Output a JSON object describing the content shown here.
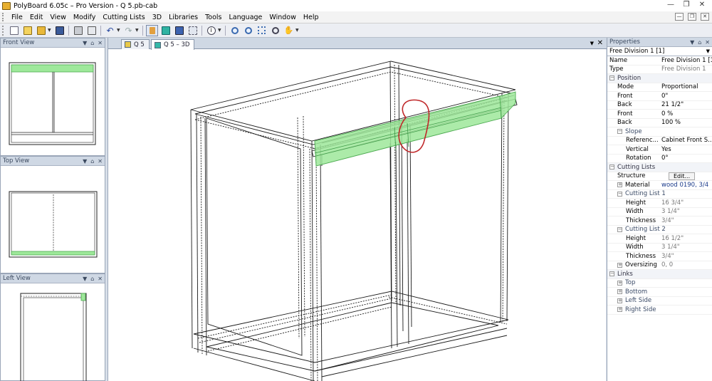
{
  "window": {
    "title": "PolyBoard 6.05c – Pro Version - Q 5.pb-cab"
  },
  "menu": {
    "items": [
      "File",
      "Edit",
      "View",
      "Modify",
      "Cutting Lists",
      "3D",
      "Libraries",
      "Tools",
      "Language",
      "Window",
      "Help"
    ]
  },
  "toolbar": {
    "icons": [
      "new-file-icon",
      "wizard-icon",
      "open-folder-icon",
      "save-icon",
      "print-icon",
      "print-preview-icon",
      "undo-icon",
      "redo-icon",
      "cursor-icon",
      "cube-icon",
      "render-icon",
      "explode-icon",
      "info-icon",
      "zoom-in-icon",
      "zoom-out-icon",
      "zoom-fit-icon",
      "zoom-window-icon",
      "pan-icon"
    ]
  },
  "panels": {
    "front_view": "Front View",
    "top_view": "Top View",
    "left_view": "Left View"
  },
  "tabs": [
    {
      "label": "Q 5"
    },
    {
      "label": "Q 5 – 3D"
    }
  ],
  "properties": {
    "header": "Properties",
    "selected": "Free Division 1 [1]",
    "rows": [
      {
        "k": "Name",
        "v": "Free Division 1 [1]",
        "kind": "plain"
      },
      {
        "k": "Type",
        "v": "Free Division 1",
        "kind": "ro"
      },
      {
        "k": "Position",
        "kind": "cat"
      },
      {
        "k": "Mode",
        "v": "Proportional",
        "kind": "ind"
      },
      {
        "k": "Front",
        "v": "0\"",
        "kind": "ind"
      },
      {
        "k": "Back",
        "v": "21 1/2\"",
        "kind": "ind"
      },
      {
        "k": "Front",
        "v": "0 %",
        "kind": "ind"
      },
      {
        "k": "Back",
        "v": "100 %",
        "kind": "ind"
      },
      {
        "k": "Slope",
        "kind": "subcat"
      },
      {
        "k": "Referenc...",
        "v": "Cabinet Front S...",
        "kind": "ind2"
      },
      {
        "k": "Vertical",
        "v": "Yes",
        "kind": "ind2"
      },
      {
        "k": "Rotation",
        "v": "0°",
        "kind": "ind2"
      },
      {
        "k": "Cutting Lists",
        "kind": "cat"
      },
      {
        "k": "Structure",
        "v": "Edit...",
        "kind": "button"
      },
      {
        "k": "Material",
        "v": "wood 0190, 3/4",
        "kind": "expand",
        "color": "#1a3a8a"
      },
      {
        "k": "Cutting List 1",
        "kind": "subcat"
      },
      {
        "k": "Height",
        "v": "16 3/4\"",
        "kind": "ind2ro"
      },
      {
        "k": "Width",
        "v": "3 1/4\"",
        "kind": "ind2ro"
      },
      {
        "k": "Thickness",
        "v": "3/4\"",
        "kind": "ind2ro"
      },
      {
        "k": "Cutting List 2",
        "kind": "subcat"
      },
      {
        "k": "Height",
        "v": "16 1/2\"",
        "kind": "ind2ro"
      },
      {
        "k": "Width",
        "v": "3 1/4\"",
        "kind": "ind2ro"
      },
      {
        "k": "Thickness",
        "v": "3/4\"",
        "kind": "ind2ro"
      },
      {
        "k": "Oversizing",
        "v": "0, 0",
        "kind": "expandro"
      },
      {
        "k": "Links",
        "kind": "cat"
      },
      {
        "k": "Top",
        "kind": "link"
      },
      {
        "k": "Bottom",
        "kind": "link"
      },
      {
        "k": "Left Side",
        "kind": "link"
      },
      {
        "k": "Right Side",
        "kind": "link"
      }
    ]
  },
  "colors": {
    "highlight": "#9ee89a",
    "highlight_stroke": "#4caa50",
    "annotation": "#c0282a",
    "panel_header": "#cfd8e4",
    "category_text": "#3a4a66"
  }
}
